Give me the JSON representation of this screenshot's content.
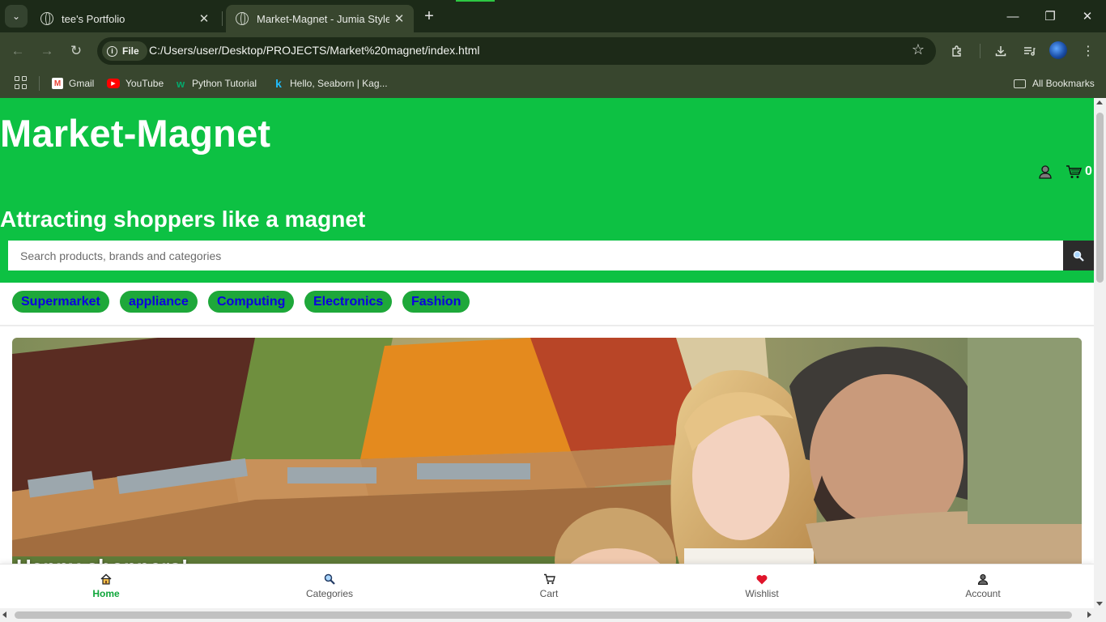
{
  "browser": {
    "tabs": [
      {
        "title": "tee's Portfolio",
        "active": false
      },
      {
        "title": "Market-Magnet - Jumia Style",
        "active": true
      }
    ],
    "address": {
      "chip_label": "File",
      "url": "C:/Users/user/Desktop/PROJECTS/Market%20magnet/index.html"
    },
    "bookmarks": [
      {
        "label": "Gmail",
        "icon": "gmail-icon"
      },
      {
        "label": "YouTube",
        "icon": "youtube-icon"
      },
      {
        "label": "Python Tutorial",
        "icon": "w3schools-icon"
      },
      {
        "label": "Hello, Seaborn | Kag...",
        "icon": "kaggle-icon"
      }
    ],
    "all_bookmarks_label": "All Bookmarks",
    "profile_icon": "profile-avatar-icon"
  },
  "site": {
    "logo": "Market-Magnet",
    "tagline": "Attracting shoppers like a magnet",
    "cart_count": "0",
    "search": {
      "placeholder": "Search products, brands and categories"
    },
    "categories": [
      "Supermarket",
      "appliance",
      "Computing",
      "Electronics",
      "Fashion"
    ],
    "hero_caption": "Happy shoppers!",
    "bottom_nav": [
      {
        "label": "Home",
        "icon": "home-icon",
        "active": true
      },
      {
        "label": "Categories",
        "icon": "search-icon",
        "active": false
      },
      {
        "label": "Cart",
        "icon": "cart-icon",
        "active": false
      },
      {
        "label": "Wishlist",
        "icon": "heart-icon",
        "active": false
      },
      {
        "label": "Account",
        "icon": "user-icon",
        "active": false
      }
    ]
  },
  "colors": {
    "header_green": "#0dc143",
    "pill_green": "#1ea83a",
    "pill_text": "#0b00e0",
    "active_nav": "#0fa63a",
    "browser_dark": "#1c2a18",
    "browser_toolbar": "#38462e"
  }
}
